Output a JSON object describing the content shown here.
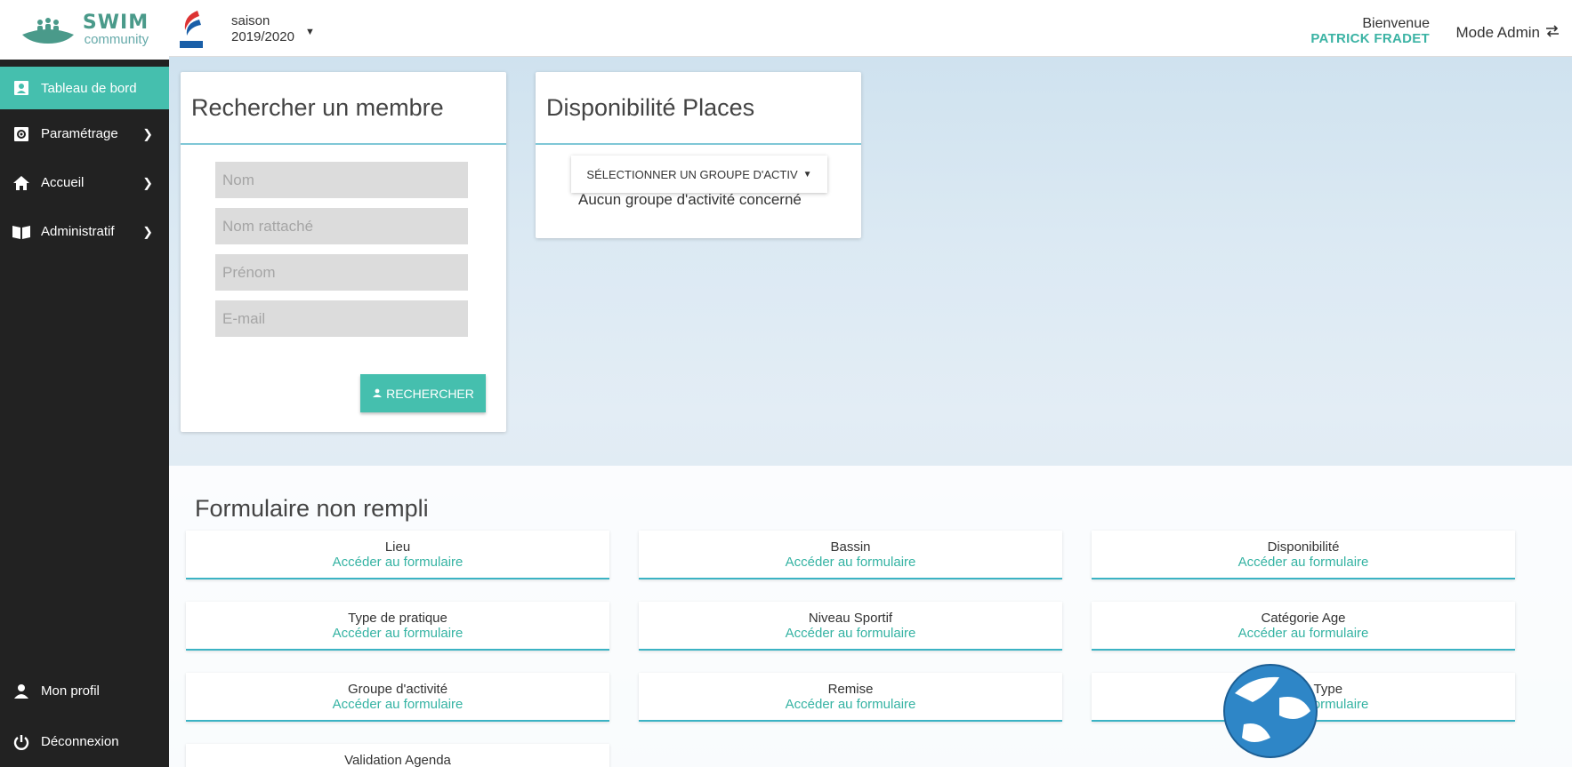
{
  "brand": {
    "swim": "SWIM",
    "community": "community"
  },
  "sidebar": {
    "items": [
      {
        "label": "Tableau de bord",
        "icon": "id-badge-icon",
        "active": true
      },
      {
        "label": "Paramétrage",
        "icon": "settings-box-icon"
      },
      {
        "label": "Accueil",
        "icon": "home-icon"
      },
      {
        "label": "Administratif",
        "icon": "book-open-icon"
      }
    ],
    "bottom": [
      {
        "label": "Mon profil",
        "icon": "user-icon"
      },
      {
        "label": "Déconnexion",
        "icon": "power-icon"
      }
    ]
  },
  "topbar": {
    "season_label": "saison",
    "season_value": "2019/2020",
    "welcome": "Bienvenue",
    "user": "PATRICK FRADET",
    "mode": "Mode Admin"
  },
  "search": {
    "title": "Rechercher un membre",
    "fields": [
      {
        "placeholder": "Nom"
      },
      {
        "placeholder": "Nom rattaché"
      },
      {
        "placeholder": "Prénom"
      },
      {
        "placeholder": "E-mail"
      }
    ],
    "button": "RECHERCHER"
  },
  "dispo": {
    "title": "Disponibilité Places",
    "select": "SÉLECTIONNER UN GROUPE D'ACTIV",
    "empty": "Aucun groupe d'activité concerné"
  },
  "forms": {
    "title": "Formulaire non rempli",
    "link": "Accéder au formulaire",
    "items": [
      {
        "label": "Lieu"
      },
      {
        "label": "Bassin"
      },
      {
        "label": "Disponibilité"
      },
      {
        "label": "Type de pratique"
      },
      {
        "label": "Niveau Sportif"
      },
      {
        "label": "Catégorie Age"
      },
      {
        "label": "Groupe d'activité"
      },
      {
        "label": "Remise"
      },
      {
        "label": "Agenda Type"
      },
      {
        "label": "Validation Agenda"
      }
    ]
  },
  "colors": {
    "accent": "#45bfae",
    "sidebar": "#222222",
    "link": "#35b3a3"
  }
}
